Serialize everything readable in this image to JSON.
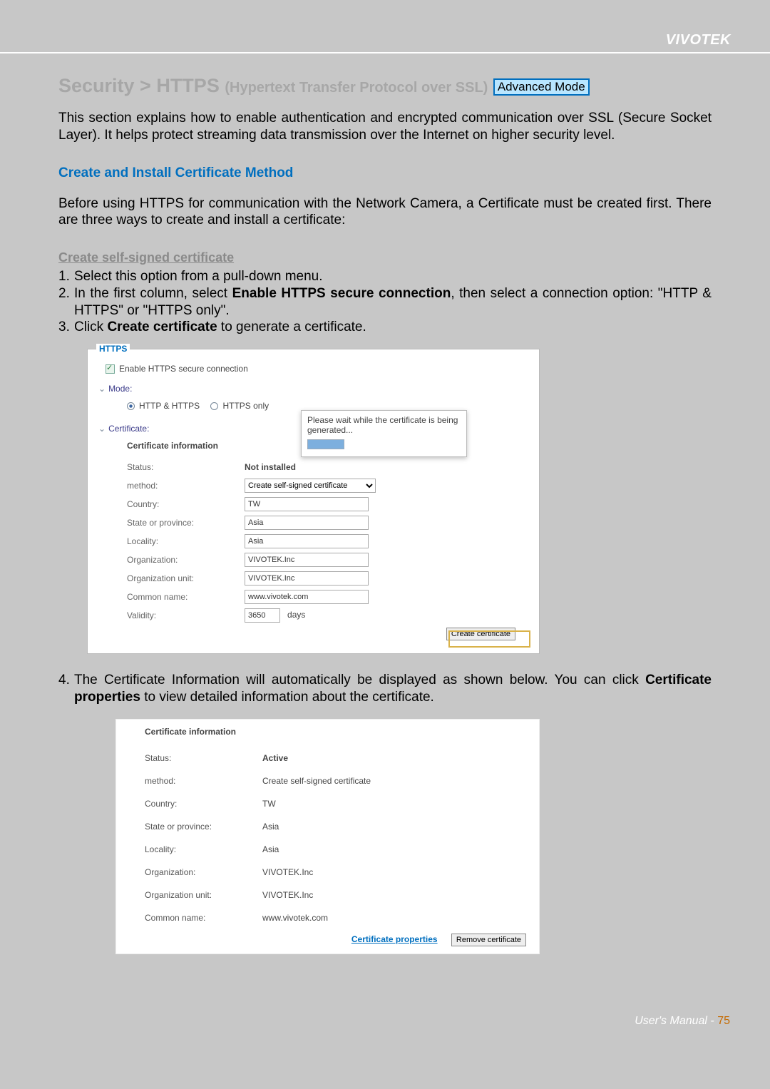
{
  "brand": "VIVOTEK",
  "header": {
    "title_main": "Security >  HTTPS",
    "title_sub": "(Hypertext Transfer Protocol over SSL)",
    "badge": "Advanced Mode"
  },
  "intro": "This section explains how to enable authentication and encrypted communication over SSL (Secure Socket Layer). It helps protect streaming data transmission over the Internet on higher security level.",
  "section1_h2": "Create and Install Certificate Method",
  "section1_p": "Before using HTTPS for communication with the Network Camera, a Certificate must be created first. There are three ways to create and install a certificate:",
  "section1_h3": "Create self-signed certificate",
  "steps1": {
    "1": "Select this option from a pull-down menu.",
    "2_pre": "In the first column, select ",
    "2_bold": "Enable HTTPS secure connection",
    "2_post": ", then select a connection option: \"HTTP & HTTPS\" or \"HTTPS only\".",
    "3_pre": "Click ",
    "3_bold": "Create certificate",
    "3_post": " to generate a certificate."
  },
  "panel1": {
    "fieldset": "HTTPS",
    "enable": "Enable HTTPS secure connection",
    "mode_label": "Mode:",
    "radio1": "HTTP & HTTPS",
    "radio2": "HTTPS only",
    "cert_label": "Certificate:",
    "cert_info_title": "Certificate information",
    "fields": {
      "status_l": "Status:",
      "status_v": "Not installed",
      "method_l": "method:",
      "method_v": "Create self-signed certificate",
      "country_l": "Country:",
      "country_v": "TW",
      "state_l": "State or province:",
      "state_v": "Asia",
      "locality_l": "Locality:",
      "locality_v": "Asia",
      "org_l": "Organization:",
      "org_v": "VIVOTEK.Inc",
      "ou_l": "Organization unit:",
      "ou_v": "VIVOTEK.Inc",
      "cn_l": "Common name:",
      "cn_v": "www.vivotek.com",
      "validity_l": "Validity:",
      "validity_v": "3650",
      "validity_unit": "days"
    },
    "create_btn": "Create certificate",
    "popup": "Please wait while the certificate is being generated..."
  },
  "steps2": {
    "4_pre": "The Certificate Information will automatically be displayed as shown below. You can click ",
    "4_bold": "Certificate properties",
    "4_post": " to view detailed information about the certificate."
  },
  "panel2": {
    "cert_info_title": "Certificate information",
    "fields": {
      "status_l": "Status:",
      "status_v": "Active",
      "method_l": "method:",
      "method_v": "Create self-signed certificate",
      "country_l": "Country:",
      "country_v": "TW",
      "state_l": "State or province:",
      "state_v": "Asia",
      "locality_l": "Locality:",
      "locality_v": "Asia",
      "org_l": "Organization:",
      "org_v": "VIVOTEK.Inc",
      "ou_l": "Organization unit:",
      "ou_v": "VIVOTEK.Inc",
      "cn_l": "Common name:",
      "cn_v": "www.vivotek.com"
    },
    "cert_prop_link": "Certificate properties",
    "remove_btn": "Remove certificate"
  },
  "footer": {
    "manual": "User's Manual - ",
    "page": "75"
  }
}
